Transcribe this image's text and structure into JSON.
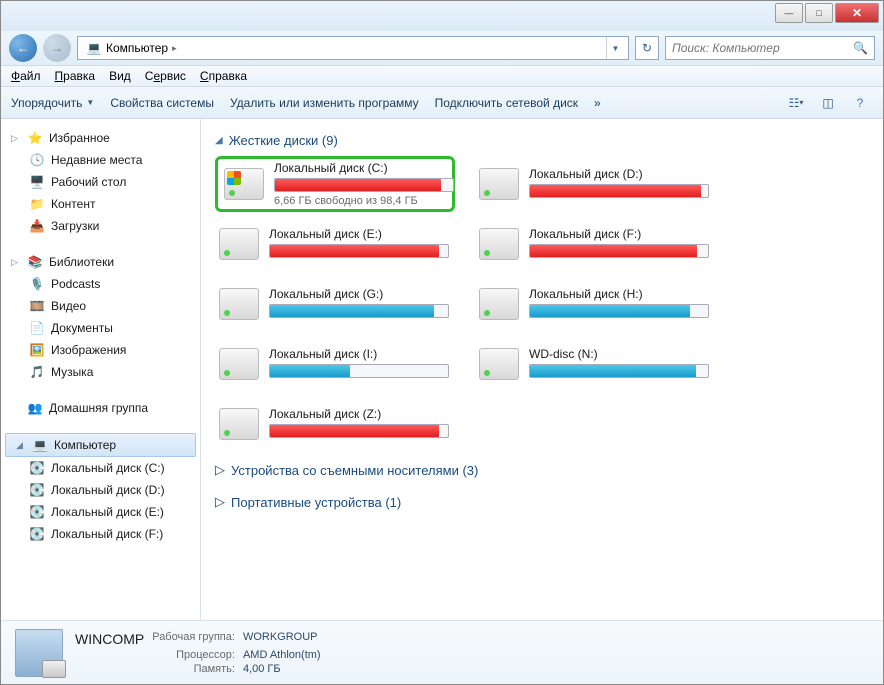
{
  "titlebar": {
    "min": "—",
    "max": "□",
    "close": "✕"
  },
  "nav": {
    "back_glyph": "←",
    "fwd_glyph": "→"
  },
  "address": {
    "location": "Компьютер",
    "sep": "▸"
  },
  "search": {
    "placeholder": "Поиск: Компьютер",
    "icon": "🔍"
  },
  "menu": {
    "file": "Файл",
    "edit": "Правка",
    "view": "Вид",
    "service": "Сервис",
    "help": "Справка"
  },
  "toolbar": {
    "organize": "Упорядочить",
    "sysprops": "Свойства системы",
    "uninstall": "Удалить или изменить программу",
    "mapdrive": "Подключить сетевой диск",
    "more": "»"
  },
  "sidebar": {
    "favorites": {
      "label": "Избранное",
      "icon": "⭐",
      "items": [
        {
          "label": "Недавние места",
          "icon": "📁"
        },
        {
          "label": "Рабочий стол",
          "icon": "🖥️"
        },
        {
          "label": "Контент",
          "icon": "📁"
        },
        {
          "label": "Загрузки",
          "icon": "📥"
        }
      ]
    },
    "libraries": {
      "label": "Библиотеки",
      "icon": "📚",
      "items": [
        {
          "label": "Podcasts",
          "icon": "🎙️"
        },
        {
          "label": "Видео",
          "icon": "🎞️"
        },
        {
          "label": "Документы",
          "icon": "📄"
        },
        {
          "label": "Изображения",
          "icon": "🖼️"
        },
        {
          "label": "Музыка",
          "icon": "🎵"
        }
      ]
    },
    "homegroup": {
      "label": "Домашняя группа",
      "icon": "👥"
    },
    "computer": {
      "label": "Компьютер",
      "icon": "💻",
      "items": [
        {
          "label": "Локальный диск (C:)",
          "icon": "💽"
        },
        {
          "label": "Локальный диск (D:)",
          "icon": "💽"
        },
        {
          "label": "Локальный диск (E:)",
          "icon": "💽"
        },
        {
          "label": "Локальный диск (F:)",
          "icon": "💽"
        }
      ]
    }
  },
  "main": {
    "hdd_header": "Жесткие диски (9)",
    "removable_header": "Устройства со съемными носителями (3)",
    "portable_header": "Портативные устройства (1)",
    "drives": [
      {
        "name": "Локальный диск (C:)",
        "free": "6,66 ГБ свободно из 98,4 ГБ",
        "fill": 93,
        "color": "red",
        "win": true,
        "hl": true
      },
      {
        "name": "Локальный диск (D:)",
        "free": "",
        "fill": 96,
        "color": "red",
        "win": false,
        "hl": false
      },
      {
        "name": "Локальный диск (E:)",
        "free": "",
        "fill": 95,
        "color": "red",
        "win": false,
        "hl": false
      },
      {
        "name": "Локальный диск (F:)",
        "free": "",
        "fill": 94,
        "color": "red",
        "win": false,
        "hl": false
      },
      {
        "name": "Локальный диск (G:)",
        "free": "",
        "fill": 92,
        "color": "blue",
        "win": false,
        "hl": false
      },
      {
        "name": "Локальный диск (H:)",
        "free": "",
        "fill": 90,
        "color": "blue",
        "win": false,
        "hl": false
      },
      {
        "name": "Локальный диск (I:)",
        "free": "",
        "fill": 45,
        "color": "blue",
        "win": false,
        "hl": false
      },
      {
        "name": "WD-disc (N:)",
        "free": "",
        "fill": 93,
        "color": "blue",
        "win": false,
        "hl": false
      },
      {
        "name": "Локальный диск (Z:)",
        "free": "",
        "fill": 95,
        "color": "red",
        "win": false,
        "hl": false
      }
    ]
  },
  "details": {
    "name": "WINCOMP",
    "workgroup_label": "Рабочая группа:",
    "workgroup": "WORKGROUP",
    "cpu_label": "Процессор:",
    "cpu": "AMD Athlon(tm)",
    "mem_label": "Память:",
    "mem": "4,00 ГБ"
  }
}
